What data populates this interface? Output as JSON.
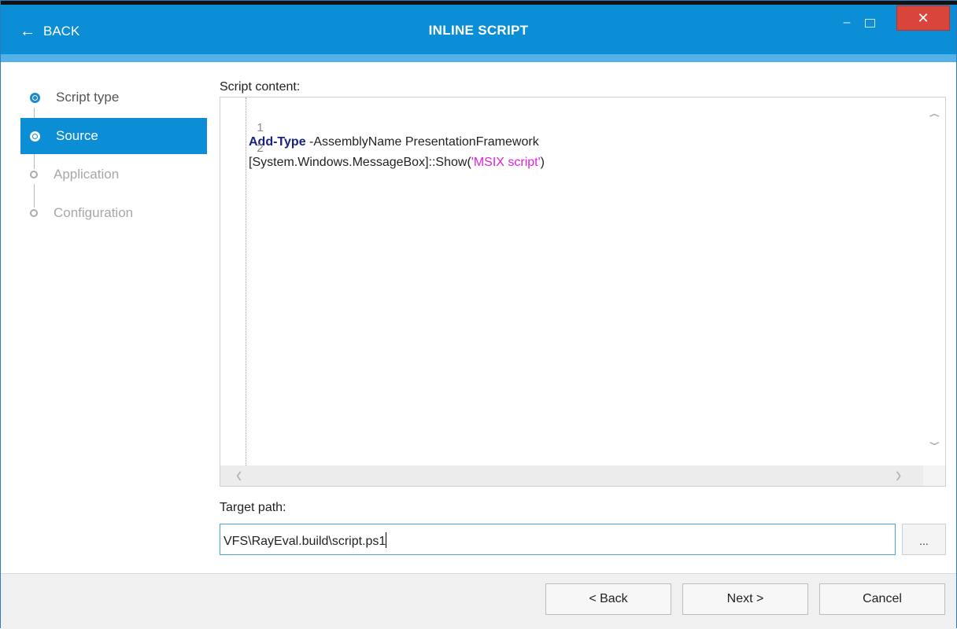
{
  "header": {
    "back_label": "BACK",
    "title": "INLINE SCRIPT",
    "minimize_glyph": "–",
    "close_glyph": "✕"
  },
  "steps": [
    {
      "label": "Script type",
      "state": "done"
    },
    {
      "label": "Source",
      "state": "active"
    },
    {
      "label": "Application",
      "state": "pending"
    },
    {
      "label": "Configuration",
      "state": "pending"
    }
  ],
  "editor": {
    "label": "Script content:",
    "lines": [
      {
        "number": "1",
        "keyword": "Add-Type",
        "text": " -AssemblyName PresentationFramework"
      },
      {
        "number": "2",
        "prefix": "[System.Windows.MessageBox]::Show(",
        "string": "'MSIX script'",
        "suffix": ")"
      }
    ]
  },
  "target": {
    "label": "Target path:",
    "value": "VFS\\RayEval.build\\script.ps1",
    "browse_label": "..."
  },
  "footer": {
    "back_button": "< Back",
    "next_button": "Next >",
    "cancel_button": "Cancel"
  },
  "colors": {
    "accent": "#0b8ed6",
    "subbar": "#55b2e8",
    "close": "#d9453a",
    "keyword": "#1a237e",
    "string": "#e020e0"
  }
}
